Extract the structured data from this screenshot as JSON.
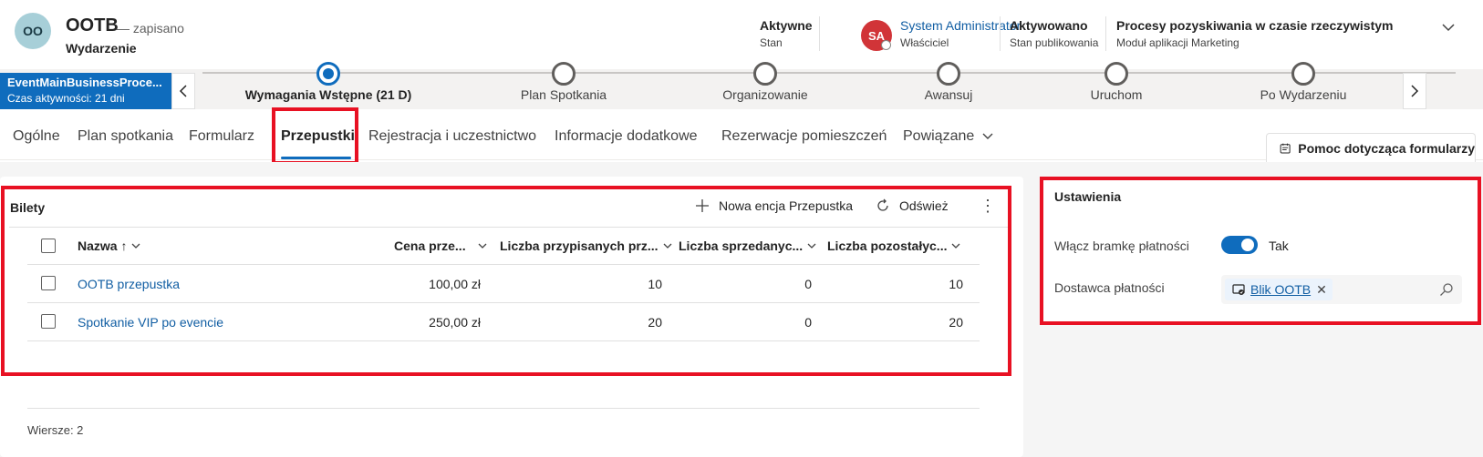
{
  "record": {
    "initials": "OO",
    "title": "OOTB",
    "saved_status": "— zapisano",
    "entity": "Wydarzenie"
  },
  "header_fields": [
    {
      "value": "Aktywne",
      "label": "Stan"
    },
    {
      "value": "System Administrator",
      "label": "Właściciel",
      "initials": "SA"
    },
    {
      "value": "Aktywowano",
      "label": "Stan publikowania"
    },
    {
      "value": "Procesy pozyskiwania w czasie rzeczywistym",
      "label": "Moduł aplikacji Marketing"
    }
  ],
  "bpf": {
    "name": "EventMainBusinessProce...",
    "duration": "Czas aktywności: 21 dni",
    "stages": [
      {
        "name": "Wymagania Wstępne  (21 D)",
        "active": true
      },
      {
        "name": "Plan Spotkania",
        "active": false
      },
      {
        "name": "Organizowanie",
        "active": false
      },
      {
        "name": "Awansuj",
        "active": false
      },
      {
        "name": "Uruchom",
        "active": false
      },
      {
        "name": "Po Wydarzeniu",
        "active": false
      }
    ]
  },
  "tabs": [
    {
      "label": "Ogólne"
    },
    {
      "label": "Plan spotkania"
    },
    {
      "label": "Formularz"
    },
    {
      "label": "Przepustki",
      "selected": true
    },
    {
      "label": "Rejestracja i uczestnictwo"
    },
    {
      "label": "Informacje dodatkowe"
    },
    {
      "label": "Rezerwacje pomieszczeń"
    },
    {
      "label": "Powiązane"
    }
  ],
  "help_button": "Pomoc dotycząca formularzy",
  "grid": {
    "title": "Bilety",
    "new_label": "Nowa encja Przepustka",
    "refresh_label": "Odśwież",
    "columns": [
      {
        "label": "Nazwa ↑"
      },
      {
        "label": "Cena prze..."
      },
      {
        "label": "Liczba przypisanych prz..."
      },
      {
        "label": "Liczba sprzedanyc..."
      },
      {
        "label": "Liczba pozostałyc..."
      }
    ],
    "rows": [
      {
        "name": "OOTB przepustka",
        "price": "100,00 zł",
        "assigned": "10",
        "sold": "0",
        "remaining": "10"
      },
      {
        "name": "Spotkanie VIP po evencie",
        "price": "250,00 zł",
        "assigned": "20",
        "sold": "0",
        "remaining": "20"
      }
    ],
    "row_count": "Wiersze: 2"
  },
  "settings": {
    "title": "Ustawienia",
    "payment_gateway_label": "Włącz bramkę płatności",
    "payment_gateway_value": "Tak",
    "payment_gateway_on": true,
    "provider_label": "Dostawca płatności",
    "provider_value": "Blik OOTB"
  },
  "colors": {
    "accent": "#0f6cbd",
    "highlight": "#e81123",
    "owner_avatar": "#d13438",
    "record_avatar": "#a7cfd8"
  }
}
